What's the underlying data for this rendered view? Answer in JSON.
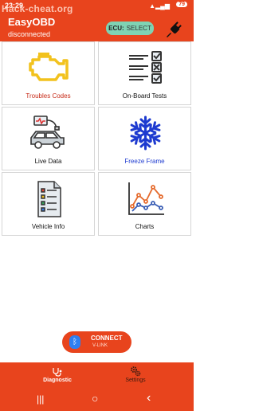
{
  "status_bar": {
    "time": "23:29",
    "battery": "79",
    "signal": "▲▂▄▆"
  },
  "watermark": "Hack-cheat.org",
  "app_bar": {
    "title": "EasyOBD",
    "subtitle": "disconnected",
    "ecu_label": "ECU:",
    "ecu_value": "SELECT"
  },
  "tiles": [
    {
      "label": "Troubles Codes",
      "icon": "engine-warning-icon",
      "color": "#c72a17"
    },
    {
      "label": "On-Board Tests",
      "icon": "checklist-icon",
      "color": "#111111"
    },
    {
      "label": "Live Data",
      "icon": "car-monitor-icon",
      "color": "#111111"
    },
    {
      "label": "Freeze Frame",
      "icon": "snowflake-icon",
      "color": "#1e3bd0"
    },
    {
      "label": "Vehicle Info",
      "icon": "document-icon",
      "color": "#111111"
    },
    {
      "label": "Charts",
      "icon": "line-chart-icon",
      "color": "#111111"
    }
  ],
  "connect": {
    "label": "CONNECT",
    "sublabel": "V-LINK"
  },
  "bottom_nav": [
    {
      "label": "Diagnostic",
      "icon": "stethoscope-icon",
      "active": true
    },
    {
      "label": "Settings",
      "icon": "gears-icon",
      "active": false
    }
  ],
  "system_nav": {
    "recent": "|||",
    "home": "○",
    "back": "‹"
  },
  "colors": {
    "brand": "#e8441d",
    "ecu_chip": "#7fd3b3",
    "bluetooth": "#2f7ff0"
  }
}
